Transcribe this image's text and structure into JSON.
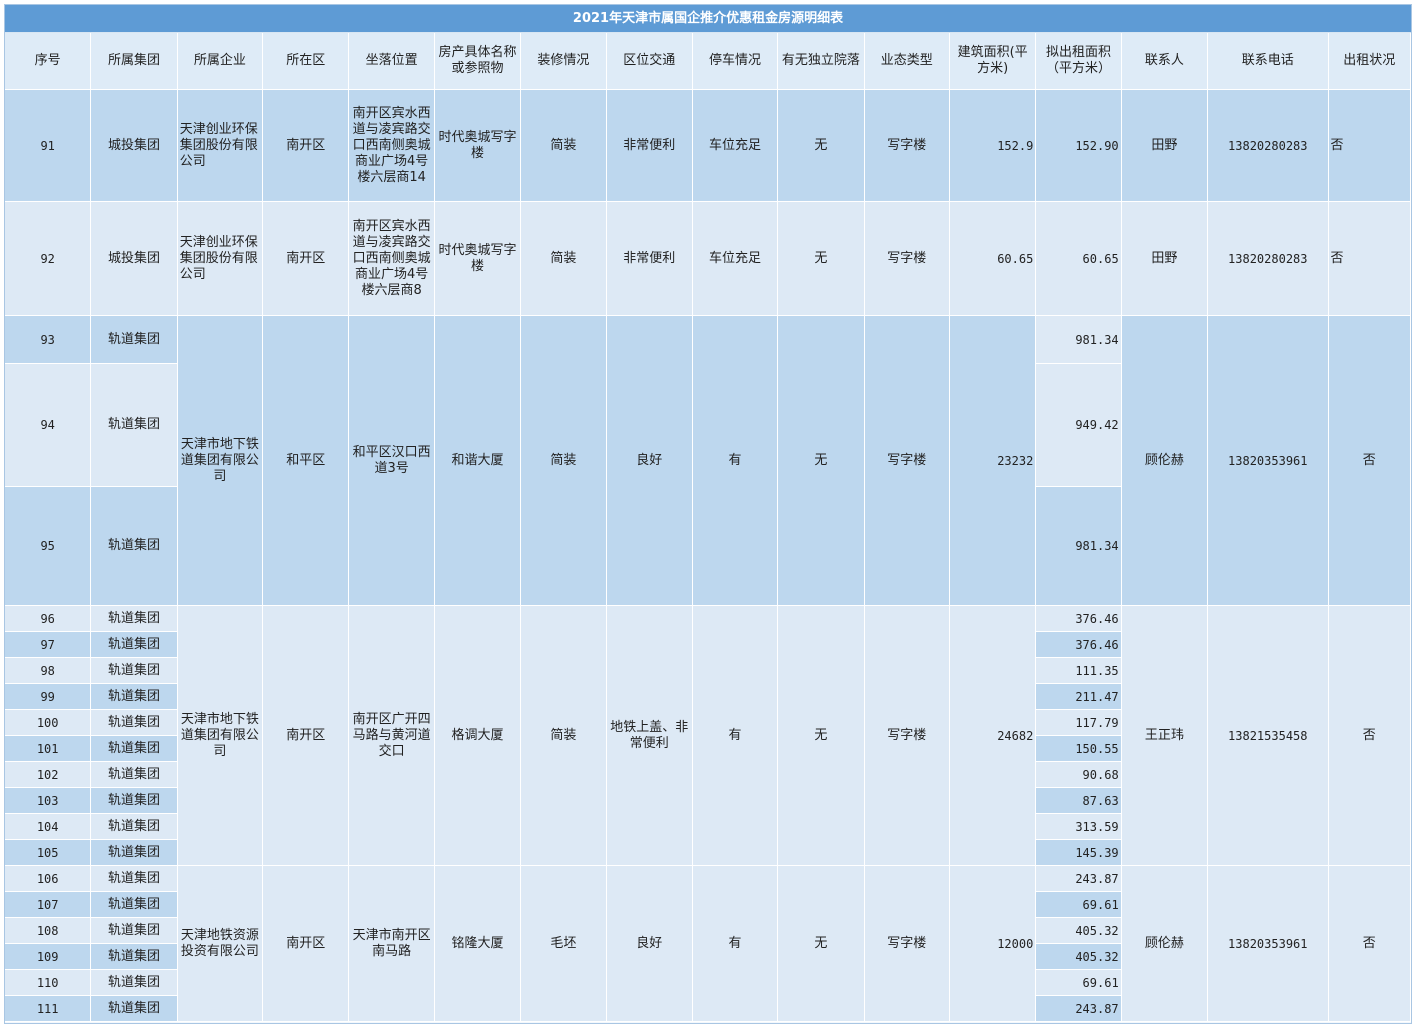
{
  "title": "2021年天津市属国企推介优惠租金房源明细表",
  "headers": [
    "序号",
    "所属集团",
    "所属企业",
    "所在区",
    "坐落位置",
    "房产具体名称或参照物",
    "装修情况",
    "区位交通",
    "停车情况",
    "有无独立院落",
    "业态类型",
    "建筑面积(平方米)",
    "拟出租面积（平方米）",
    "联系人",
    "联系电话",
    "出租状况"
  ],
  "rows": [
    {
      "no": "91",
      "group": "城投集团",
      "company": "天津创业环保集团股份有限公司",
      "district": "南开区",
      "location": "南开区宾水西道与凌宾路交口西南侧奥城商业广场4号楼六层商14",
      "property": "时代奥城写字楼",
      "decoration": "简装",
      "traffic": "非常便利",
      "parking": "车位充足",
      "courtyard": "无",
      "type": "写字楼",
      "building_area": "152.9",
      "rent_area": "152.90",
      "contact": "田野",
      "phone": "13820280283",
      "status": "否"
    },
    {
      "no": "92",
      "group": "城投集团",
      "company": "天津创业环保集团股份有限公司",
      "district": "南开区",
      "location": "南开区宾水西道与凌宾路交口西南侧奥城商业广场4号楼六层商8",
      "property": "时代奥城写字楼",
      "decoration": "简装",
      "traffic": "非常便利",
      "parking": "车位充足",
      "courtyard": "无",
      "type": "写字楼",
      "building_area": "60.65",
      "rent_area": "60.65",
      "contact": "田野",
      "phone": "13820280283",
      "status": "否"
    }
  ],
  "block_a": {
    "company": "天津市地下铁道集团有限公司",
    "district": "和平区",
    "location": "和平区汉口西道3号",
    "property": "和谐大厦",
    "decoration": "简装",
    "traffic": "良好",
    "parking": "有",
    "courtyard": "无",
    "type": "写字楼",
    "building_area": "23232",
    "contact": "顾伦赫",
    "phone": "13820353961",
    "status": "否",
    "items": [
      {
        "no": "93",
        "group": "轨道集团",
        "rent_area": "981.34"
      },
      {
        "no": "94",
        "group": "轨道集团",
        "rent_area": "949.42"
      },
      {
        "no": "95",
        "group": "轨道集团",
        "rent_area": "981.34"
      }
    ]
  },
  "block_b": {
    "company": "天津市地下铁道集团有限公司",
    "district": "南开区",
    "location": "南开区广开四马路与黄河道交口",
    "property": "格调大厦",
    "decoration": "简装",
    "traffic": "地铁上盖、非常便利",
    "parking": "有",
    "courtyard": "无",
    "type": "写字楼",
    "building_area": "24682",
    "contact": "王正玮",
    "phone": "13821535458",
    "status": "否",
    "items": [
      {
        "no": "96",
        "group": "轨道集团",
        "rent_area": "376.46"
      },
      {
        "no": "97",
        "group": "轨道集团",
        "rent_area": "376.46"
      },
      {
        "no": "98",
        "group": "轨道集团",
        "rent_area": "111.35"
      },
      {
        "no": "99",
        "group": "轨道集团",
        "rent_area": "211.47"
      },
      {
        "no": "100",
        "group": "轨道集团",
        "rent_area": "117.79"
      },
      {
        "no": "101",
        "group": "轨道集团",
        "rent_area": "150.55"
      },
      {
        "no": "102",
        "group": "轨道集团",
        "rent_area": "90.68"
      },
      {
        "no": "103",
        "group": "轨道集团",
        "rent_area": "87.63"
      },
      {
        "no": "104",
        "group": "轨道集团",
        "rent_area": "313.59"
      },
      {
        "no": "105",
        "group": "轨道集团",
        "rent_area": "145.39"
      }
    ]
  },
  "block_c": {
    "company": "天津地铁资源投资有限公司",
    "district": "南开区",
    "location": "天津市南开区南马路",
    "property": "铭隆大厦",
    "decoration": "毛坯",
    "traffic": "良好",
    "parking": "有",
    "courtyard": "无",
    "type": "写字楼",
    "building_area": "12000",
    "contact": "顾伦赫",
    "phone": "13820353961",
    "status": "否",
    "items": [
      {
        "no": "106",
        "group": "轨道集团",
        "rent_area": "243.87"
      },
      {
        "no": "107",
        "group": "轨道集团",
        "rent_area": "69.61"
      },
      {
        "no": "108",
        "group": "轨道集团",
        "rent_area": "405.32"
      },
      {
        "no": "109",
        "group": "轨道集团",
        "rent_area": "405.32"
      },
      {
        "no": "110",
        "group": "轨道集团",
        "rent_area": "69.61"
      },
      {
        "no": "111",
        "group": "轨道集团",
        "rent_area": "243.87"
      }
    ]
  },
  "colors": {
    "title_bar": "#5e9bd5",
    "header": "#deebf7",
    "band_dark": "#bdd7ee",
    "band_light": "#dde9f5"
  }
}
